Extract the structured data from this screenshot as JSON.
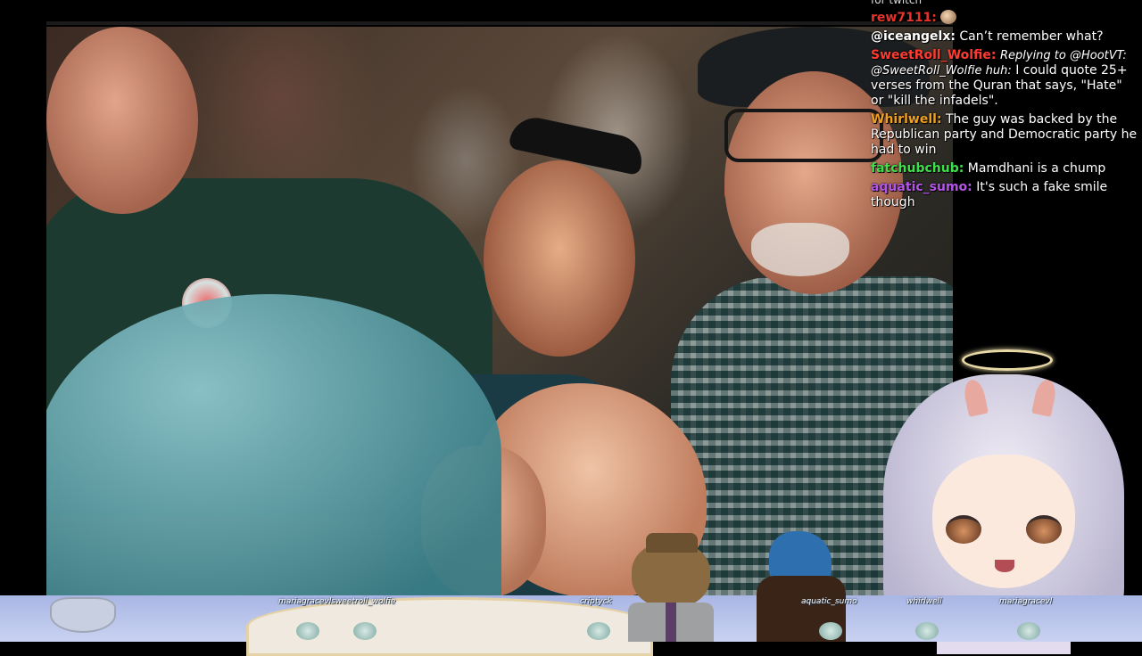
{
  "stream": {
    "video_label": "",
    "chat": [
      {
        "user": "rew7111:",
        "user_color": "#e8322c",
        "text": "",
        "emote": "face-emote"
      },
      {
        "user": "@iceangelx:",
        "user_color": "#ffffff",
        "text": "Can’t remember what?"
      },
      {
        "user": "SweetRoll_Wolfie:",
        "user_color": "#ff3b30",
        "reply": "Replying to @HootVT: @SweetRoll_Wolfie huh:",
        "text": "I could quote 25+ verses from the Quran that says, \"Hate\" or \"kill the infadels\"."
      },
      {
        "user": "Whirlwell:",
        "user_color": "#f0a021",
        "text": "The guy was backed by the Republican party and Democratic party he had to win"
      },
      {
        "user": "fatchubchub:",
        "user_color": "#3de04a",
        "text": "Mamdhani is a chump"
      },
      {
        "user": "aquatic_sumo:",
        "user_color": "#b455e8",
        "text": "It's such a fake smile though"
      }
    ],
    "chat_header_partial": "for twitch",
    "stage_names": [
      {
        "name": "mariagracevlsweetroll_wolfie"
      },
      {
        "name": "criptyck"
      },
      {
        "name": "aquatic_sumo"
      },
      {
        "name": "whirlwell"
      },
      {
        "name": "mariagracevl"
      }
    ]
  }
}
